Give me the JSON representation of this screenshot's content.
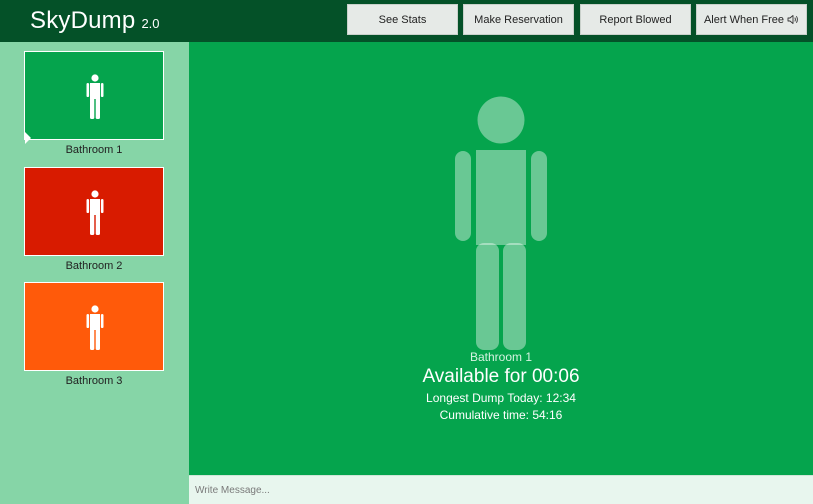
{
  "app": {
    "name": "SkyDump",
    "version": "2.0"
  },
  "toolbar": {
    "buttons": [
      {
        "label": "See Stats"
      },
      {
        "label": "Make Reservation"
      },
      {
        "label": "Report Blowed"
      },
      {
        "label": "Alert When Free",
        "icon": "speaker-icon"
      }
    ]
  },
  "sidebar": {
    "bathrooms": [
      {
        "label": "Bathroom 1",
        "status": "available",
        "color": "#05a44d",
        "selected": true,
        "icon": "person-icon"
      },
      {
        "label": "Bathroom 2",
        "status": "occupied",
        "color": "#d81b00",
        "selected": false,
        "icon": "person-icon"
      },
      {
        "label": "Bathroom 3",
        "status": "warning",
        "color": "#ff5a0a",
        "selected": false,
        "icon": "person-icon"
      }
    ]
  },
  "main": {
    "bathroom_name": "Bathroom 1",
    "status": "Available for 00:06",
    "longest_dump": "Longest Dump Today: 12:34",
    "cumulative": "Cumulative time: 54:16",
    "icon": "person-icon"
  },
  "message": {
    "placeholder": "Write Message...",
    "value": ""
  },
  "colors": {
    "header": "#045128",
    "main": "#05a44d",
    "sidebar": "#86d5a7",
    "available": "#05a44d",
    "occupied": "#d81b00",
    "warning": "#ff5a0a"
  }
}
